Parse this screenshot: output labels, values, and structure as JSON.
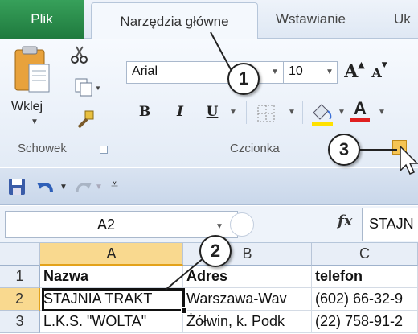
{
  "tabs": {
    "file": "Plik",
    "home": "Narzędzia główne",
    "insert": "Wstawianie",
    "next_partial": "Uk"
  },
  "ribbon": {
    "paste_label": "Wklej",
    "clipboard_group": "Schowek",
    "font_group": "Czcionka",
    "font_name": "Arial",
    "font_size": "10",
    "bold": "B",
    "italic": "I",
    "underline": "U",
    "grow_font": "A",
    "shrink_font": "A",
    "font_color": "A",
    "font_color_accent": "#e02020",
    "highlight_accent": "#ffe100"
  },
  "formula_bar": {
    "name_box": "A2",
    "fx": "fx",
    "value": "STAJN"
  },
  "grid": {
    "columns": [
      "A",
      "B",
      "C"
    ],
    "rows": [
      {
        "num": "1",
        "cells": [
          "Nazwa",
          "Adres",
          "telefon"
        ]
      },
      {
        "num": "2",
        "cells": [
          "STAJNIA TRAKT",
          "Warszawa-Wav",
          "(602) 66-32-9"
        ]
      },
      {
        "num": "3",
        "cells": [
          "L.K.S. \"WOLTA\"",
          "Żółwin, k. Podk",
          "(22) 758-91-2"
        ]
      }
    ]
  },
  "callouts": [
    "1",
    "2",
    "3"
  ]
}
